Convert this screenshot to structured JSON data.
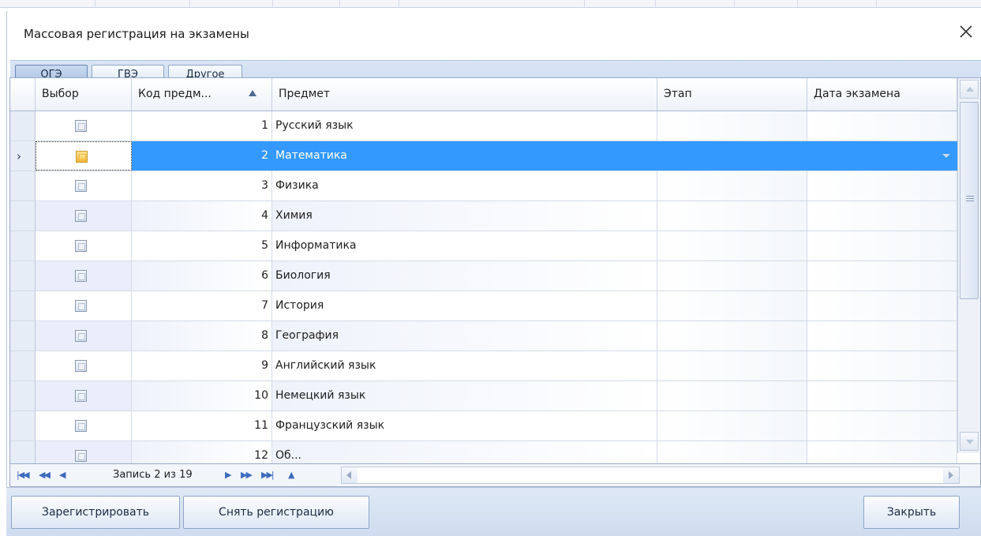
{
  "window": {
    "title": "Массовая регистрация на экзамены"
  },
  "tabs": [
    {
      "label": "ОГЭ",
      "active": true
    },
    {
      "label": "ГВЭ",
      "active": false
    },
    {
      "label": "Другое",
      "active": false
    }
  ],
  "grid": {
    "columns": [
      {
        "label": "Выбор"
      },
      {
        "label": "Код предм...",
        "sorted": "ascending"
      },
      {
        "label": "Предмет"
      },
      {
        "label": "Этап"
      },
      {
        "label": "Дата экзамена"
      }
    ],
    "rows": [
      {
        "checked": false,
        "code": "1",
        "subject": "Русский язык",
        "stage": "",
        "date": ""
      },
      {
        "checked": false,
        "code": "2",
        "subject": "Математика",
        "stage": "",
        "date": "",
        "selected": true
      },
      {
        "checked": false,
        "code": "3",
        "subject": "Физика",
        "stage": "",
        "date": ""
      },
      {
        "checked": false,
        "code": "4",
        "subject": "Химия",
        "stage": "",
        "date": ""
      },
      {
        "checked": false,
        "code": "5",
        "subject": "Информатика",
        "stage": "",
        "date": ""
      },
      {
        "checked": false,
        "code": "6",
        "subject": "Биология",
        "stage": "",
        "date": ""
      },
      {
        "checked": false,
        "code": "7",
        "subject": "История",
        "stage": "",
        "date": ""
      },
      {
        "checked": false,
        "code": "8",
        "subject": "География",
        "stage": "",
        "date": ""
      },
      {
        "checked": false,
        "code": "9",
        "subject": "Английский язык",
        "stage": "",
        "date": ""
      },
      {
        "checked": false,
        "code": "10",
        "subject": "Немецкий язык",
        "stage": "",
        "date": ""
      },
      {
        "checked": false,
        "code": "11",
        "subject": "Французский язык",
        "stage": "",
        "date": ""
      },
      {
        "checked": false,
        "code": "12",
        "subject": "Об...",
        "stage": "",
        "date": ""
      }
    ]
  },
  "navigator": {
    "record_text": "Запись 2 из 19"
  },
  "footer": {
    "register_label": "Зарегистрировать",
    "unregister_label": "Снять регистрацию",
    "close_label": "Закрыть"
  },
  "colors": {
    "selection": "#3399ff",
    "tabs_background": "#d9e5f5",
    "grid_border": "#99abc7",
    "navigator_arrows": "#3d6bbd"
  }
}
